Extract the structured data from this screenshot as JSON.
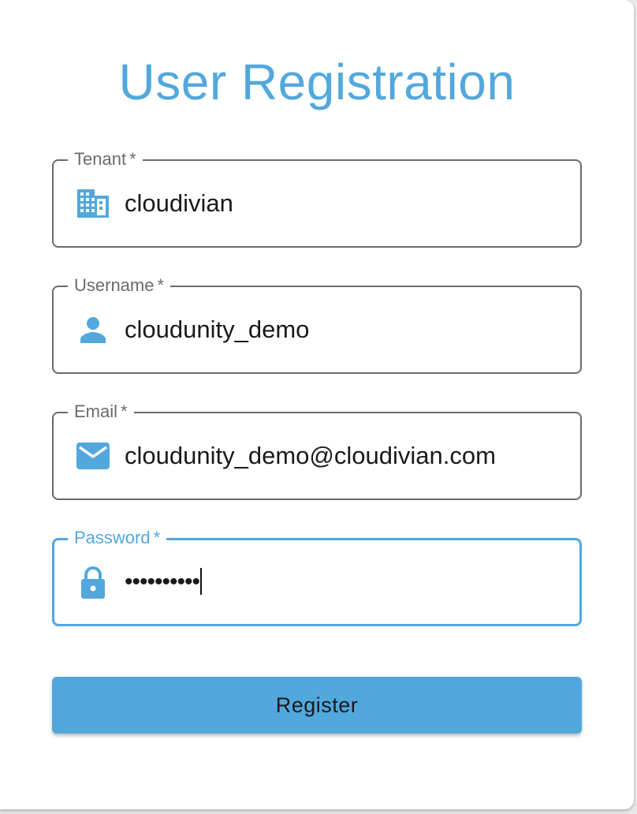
{
  "title": "User Registration",
  "colors": {
    "accent": "#52a8dd",
    "outline": "#6b6b6b",
    "text": "#1a1a1a"
  },
  "fields": [
    {
      "id": "tenant",
      "label": "Tenant",
      "required_mark": "*",
      "value": "cloudivian",
      "icon": "building-icon"
    },
    {
      "id": "username",
      "label": "Username",
      "required_mark": "*",
      "value": "cloudunity_demo",
      "icon": "person-icon"
    },
    {
      "id": "email",
      "label": "Email",
      "required_mark": "*",
      "value": "cloudunity_demo@cloudivian.com",
      "icon": "mail-icon"
    },
    {
      "id": "password",
      "label": "Password",
      "required_mark": "*",
      "value": "••••••••••",
      "icon": "lock-icon",
      "focused": true
    }
  ],
  "register_label": "Register"
}
